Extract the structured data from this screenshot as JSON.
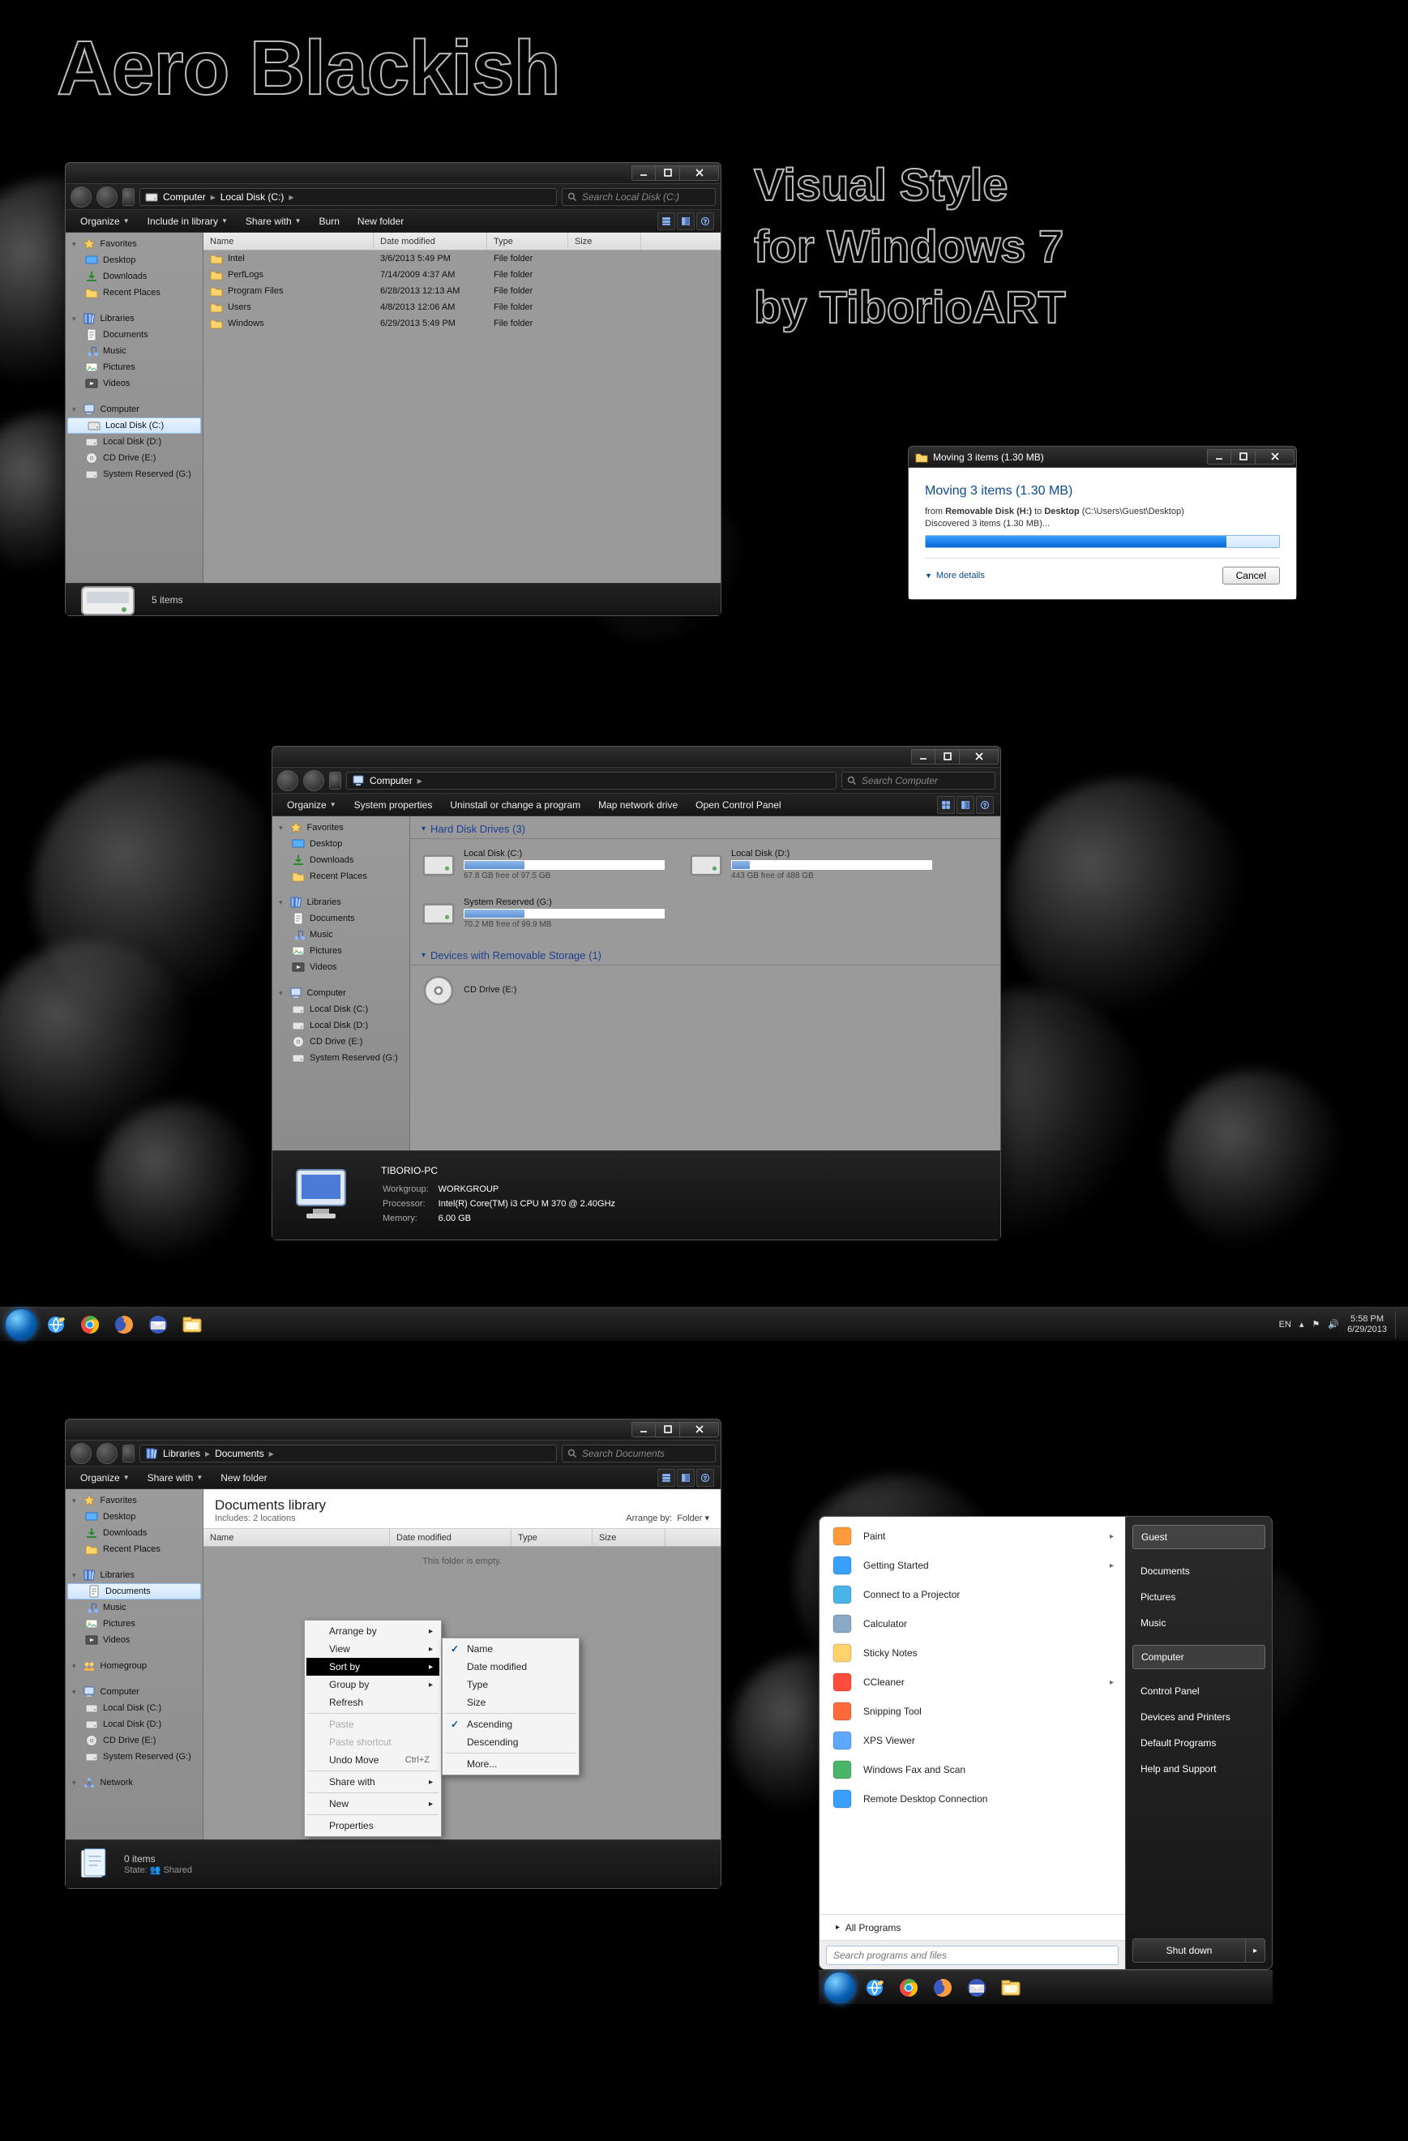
{
  "headline": {
    "main": "Aero Blackish",
    "sub": "Visual Style\nfor Windows 7\nby TiborioART"
  },
  "win1": {
    "address": [
      "Computer",
      "Local Disk (C:)"
    ],
    "searchPlaceholder": "Search Local Disk (C:)",
    "toolbar": {
      "organize": "Organize",
      "include": "Include in library",
      "share": "Share with",
      "burn": "Burn",
      "newfolder": "New folder"
    },
    "cols": {
      "name": "Name",
      "date": "Date modified",
      "type": "Type",
      "size": "Size"
    },
    "rows": [
      {
        "name": "Intel",
        "date": "3/6/2013 5:49 PM",
        "type": "File folder"
      },
      {
        "name": "PerfLogs",
        "date": "7/14/2009 4:37 AM",
        "type": "File folder"
      },
      {
        "name": "Program Files",
        "date": "6/28/2013 12:13 AM",
        "type": "File folder"
      },
      {
        "name": "Users",
        "date": "4/8/2013 12:06 AM",
        "type": "File folder"
      },
      {
        "name": "Windows",
        "date": "6/29/2013 5:49 PM",
        "type": "File folder"
      }
    ],
    "status": "5 items"
  },
  "sidebar": {
    "favorites": {
      "label": "Favorites",
      "items": [
        "Desktop",
        "Downloads",
        "Recent Places"
      ]
    },
    "libraries": {
      "label": "Libraries",
      "items": [
        "Documents",
        "Music",
        "Pictures",
        "Videos"
      ]
    },
    "computer": {
      "label": "Computer",
      "items": [
        "Local Disk (C:)",
        "Local Disk (D:)",
        "CD Drive (E:)",
        "System Reserved (G:)"
      ]
    },
    "homegroup": {
      "label": "Homegroup"
    },
    "network": {
      "label": "Network"
    }
  },
  "moveDlg": {
    "title": "Moving 3 items (1.30 MB)",
    "heading": "Moving 3 items (1.30 MB)",
    "line1_a": "from ",
    "line1_b": "Removable Disk (H:)",
    "line1_c": " to ",
    "line1_d": "Desktop",
    "line1_e": " (C:\\Users\\Guest\\Desktop)",
    "line2": "Discovered 3 items (1.30 MB)...",
    "more": "More details",
    "cancel": "Cancel"
  },
  "win3": {
    "address": [
      "Computer"
    ],
    "searchPlaceholder": "Search Computer",
    "toolbar": {
      "organize": "Organize",
      "sysprop": "System properties",
      "uninstall": "Uninstall or change a program",
      "mapnet": "Map network drive",
      "opencp": "Open Control Panel"
    },
    "cat1": "Hard Disk Drives (3)",
    "cat2": "Devices with Removable Storage (1)",
    "drives": [
      {
        "name": "Local Disk (C:)",
        "free": "67.8 GB free of 97.5 GB",
        "fill": 0.3
      },
      {
        "name": "Local Disk (D:)",
        "free": "443 GB free of 488 GB",
        "fill": 0.09
      },
      {
        "name": "System Reserved (G:)",
        "free": "70.2 MB free of 99.9 MB",
        "fill": 0.3
      }
    ],
    "cdDrive": "CD Drive (E:)",
    "pcname": "TIBORIO-PC",
    "details": {
      "Workgroup": "WORKGROUP",
      "Processor": "Intel(R) Core(TM) i3 CPU       M 370  @ 2.40GHz",
      "Memory": "6.00 GB"
    }
  },
  "taskbar": {
    "lang": "EN",
    "time": "5:58 PM",
    "date": "6/29/2013",
    "apps": [
      "internet-explorer",
      "chrome",
      "firefox",
      "thunderbird",
      "explorer"
    ]
  },
  "win4": {
    "address": [
      "Libraries",
      "Documents"
    ],
    "searchPlaceholder": "Search Documents",
    "toolbar": {
      "organize": "Organize",
      "share": "Share with",
      "newfolder": "New folder"
    },
    "lib": {
      "title": "Documents library",
      "sub": "Includes: 2 locations",
      "arrange": "Arrange by:",
      "arrangeVal": "Folder"
    },
    "cols": {
      "name": "Name",
      "date": "Date modified",
      "type": "Type",
      "size": "Size"
    },
    "empty": "This folder is empty.",
    "status": "0 items",
    "state": "State:",
    "stateVal": "Shared"
  },
  "ctx1": [
    {
      "t": "Arrange by",
      "sub": true
    },
    {
      "t": "View",
      "sub": true
    },
    {
      "t": "Sort by",
      "sub": true,
      "sel": true
    },
    {
      "t": "Group by",
      "sub": true
    },
    {
      "t": "Refresh"
    },
    {
      "hr": true
    },
    {
      "t": "Paste",
      "dis": true
    },
    {
      "t": "Paste shortcut",
      "dis": true
    },
    {
      "t": "Undo Move",
      "sc": "Ctrl+Z"
    },
    {
      "hr": true
    },
    {
      "t": "Share with",
      "sub": true
    },
    {
      "hr": true
    },
    {
      "t": "New",
      "sub": true
    },
    {
      "hr": true
    },
    {
      "t": "Properties"
    }
  ],
  "ctx2": [
    {
      "t": "Name",
      "chk": true
    },
    {
      "t": "Date modified"
    },
    {
      "t": "Type"
    },
    {
      "t": "Size"
    },
    {
      "hr": true
    },
    {
      "t": "Ascending",
      "chk": true
    },
    {
      "t": "Descending"
    },
    {
      "hr": true
    },
    {
      "t": "More..."
    }
  ],
  "startmenu": {
    "programs": [
      {
        "t": "Paint",
        "sub": true,
        "c": "#ff9a3d"
      },
      {
        "t": "Getting Started",
        "sub": true,
        "c": "#3aa0ff"
      },
      {
        "t": "Connect to a Projector",
        "c": "#4ab4e6"
      },
      {
        "t": "Calculator",
        "c": "#8aa9c5"
      },
      {
        "t": "Sticky Notes",
        "c": "#ffd36b"
      },
      {
        "t": "CCleaner",
        "sub": true,
        "c": "#ff4d3d"
      },
      {
        "t": "Snipping Tool",
        "c": "#ff6a3d"
      },
      {
        "t": "XPS Viewer",
        "c": "#5fa8ff"
      },
      {
        "t": "Windows Fax and Scan",
        "c": "#4ab46a"
      },
      {
        "t": "Remote Desktop Connection",
        "c": "#3aa0ff"
      }
    ],
    "allPrograms": "All Programs",
    "searchPlaceholder": "Search programs and files",
    "rightItems": [
      "Guest",
      "Documents",
      "Pictures",
      "Music",
      "Computer",
      "Control Panel",
      "Devices and Printers",
      "Default Programs",
      "Help and Support"
    ],
    "rightHighlight": [
      0,
      4
    ],
    "shutdown": "Shut down"
  }
}
